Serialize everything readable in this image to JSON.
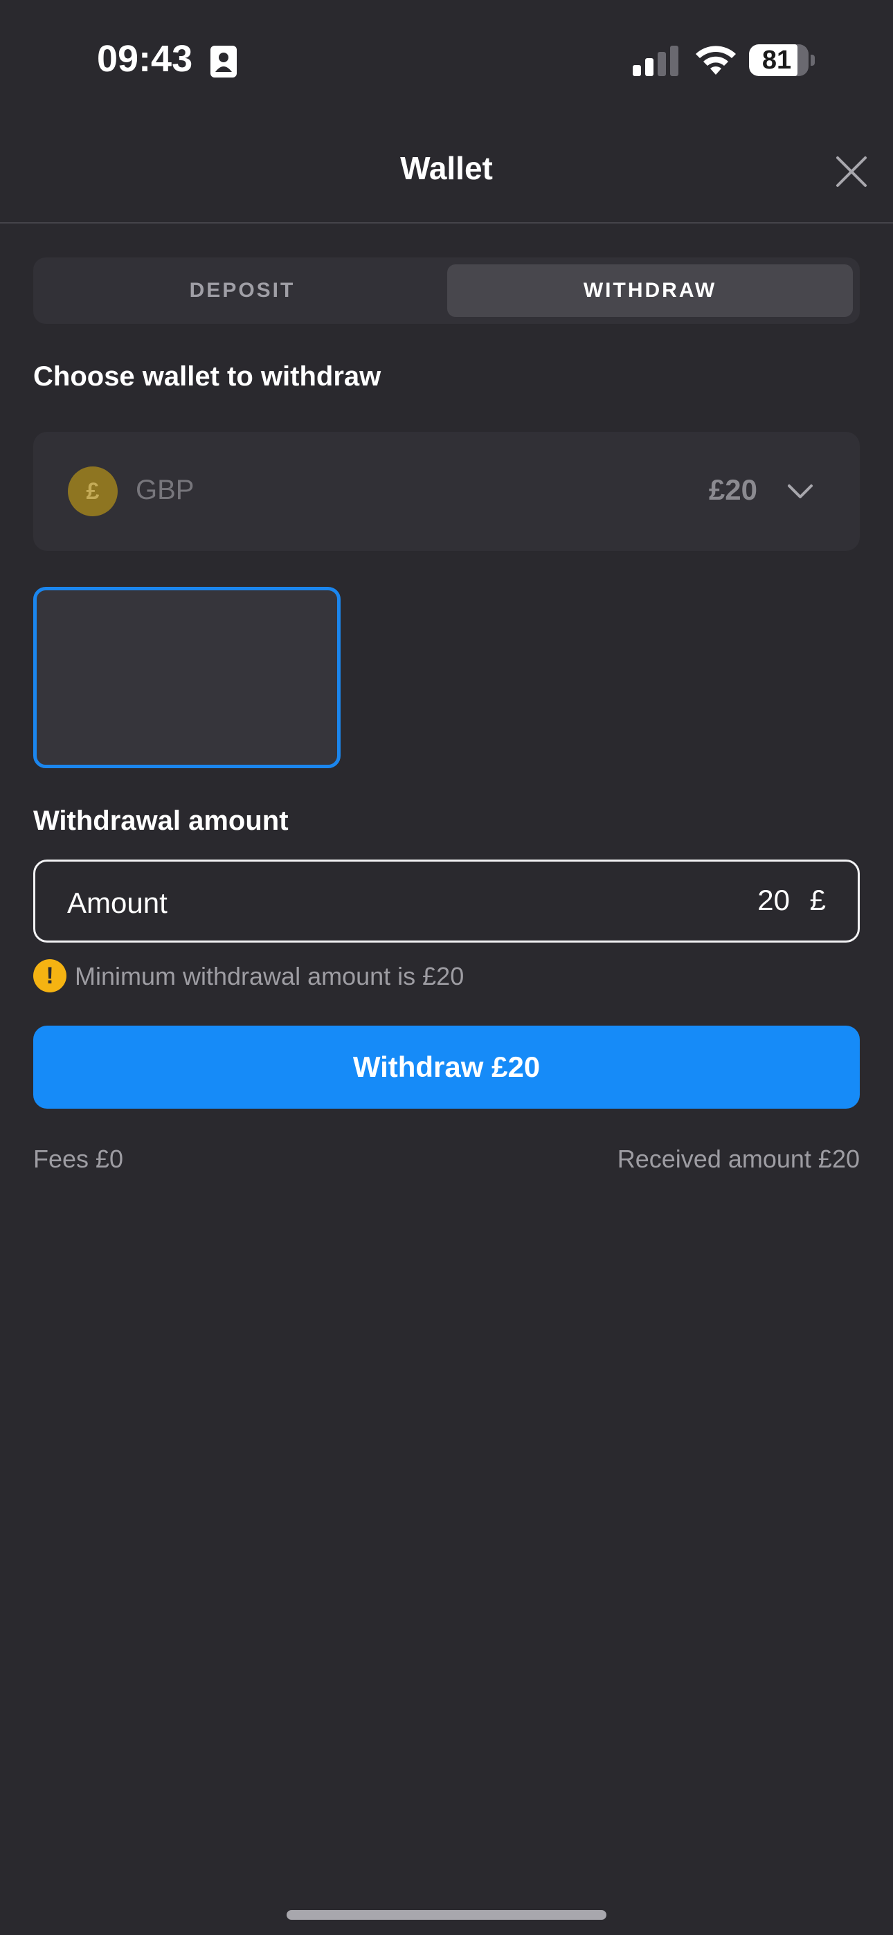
{
  "status_bar": {
    "time": "09:43",
    "battery_level": "81",
    "battery_fraction": 0.81
  },
  "header": {
    "title": "Wallet"
  },
  "tabs": [
    {
      "label": "DEPOSIT",
      "selected": false
    },
    {
      "label": "WITHDRAW",
      "selected": true
    }
  ],
  "wallet_section": {
    "heading": "Choose wallet to withdraw",
    "selected_wallet": {
      "symbol": "£",
      "currency": "GBP",
      "balance": "£20"
    }
  },
  "amount_section": {
    "heading": "Withdrawal amount",
    "input_label": "Amount",
    "input_value": "20",
    "input_currency": "£",
    "warning_icon": "!",
    "warning_text": "Minimum withdrawal amount is £20"
  },
  "actions": {
    "withdraw_label": "Withdraw £20"
  },
  "summary": {
    "fees": "Fees £0",
    "received": "Received amount £20"
  },
  "colors": {
    "background": "#2a292e",
    "accent": "#168bf8",
    "warning": "#f5b312",
    "coin": "#8e7521"
  }
}
